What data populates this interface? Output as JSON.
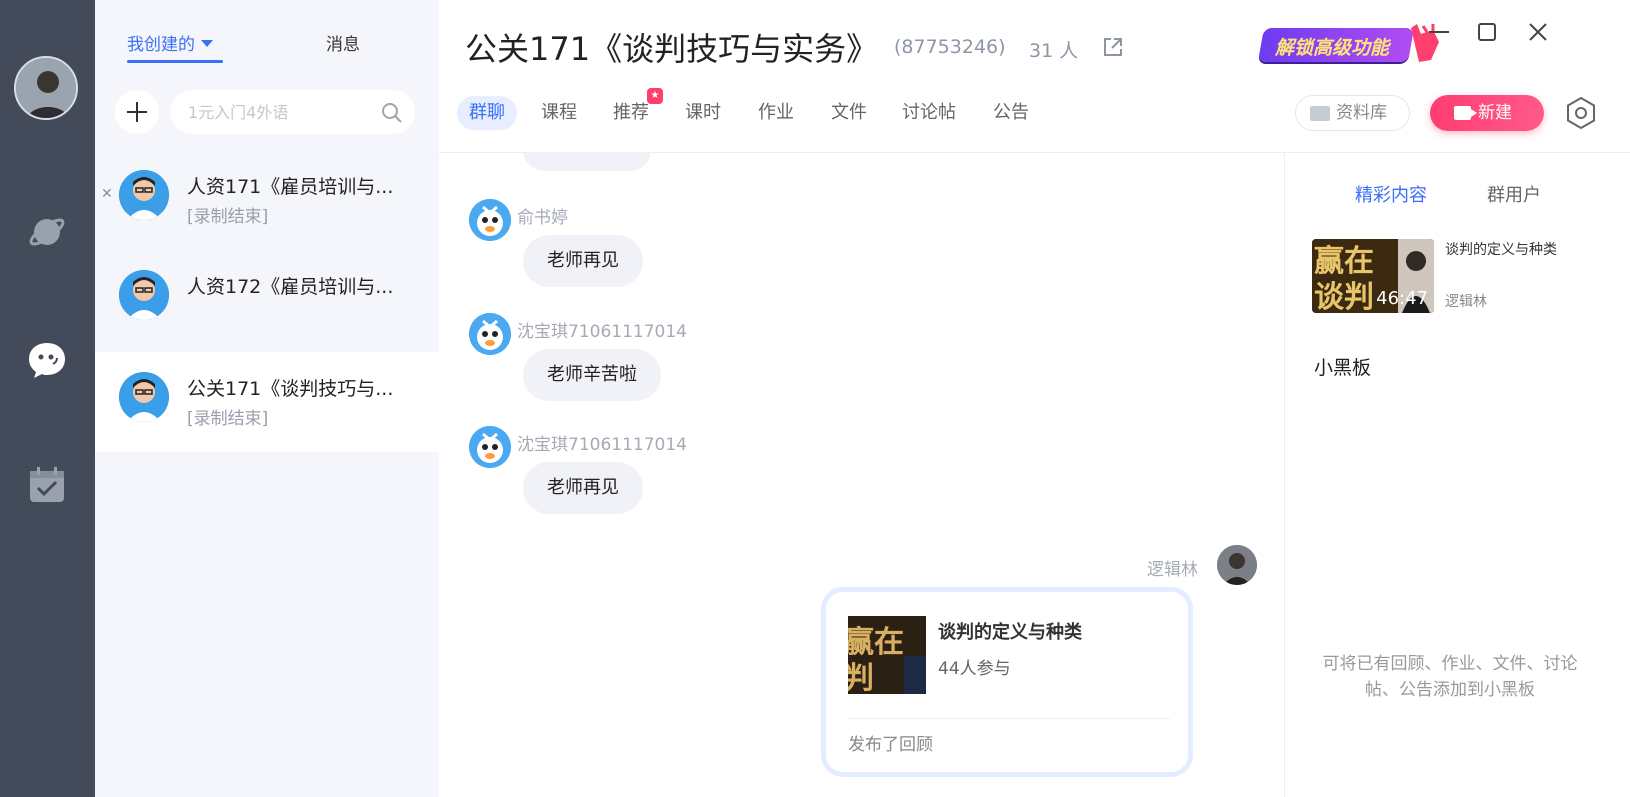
{
  "rail": {
    "icons": [
      "planet-icon",
      "chat-bubble-icon",
      "calendar-check-icon"
    ]
  },
  "sessions": {
    "tab_mine": "我创建的",
    "tab_messages": "消息",
    "search_placeholder": "1元入门4外语",
    "items": [
      {
        "name": "人资171《雇员培训与...",
        "status": "[录制结束]"
      },
      {
        "name": "人资172《雇员培训与...",
        "status": ""
      },
      {
        "name": "公关171《谈判技巧与...",
        "status": "[录制结束]"
      }
    ]
  },
  "header": {
    "title": "公关171《谈判技巧与实务》",
    "group_id": "(87753246)",
    "member_count": "31 人",
    "unlock_label": "解锁高级功能",
    "tabs": [
      "群聊",
      "课程",
      "推荐",
      "课时",
      "作业",
      "文件",
      "讨论帖",
      "公告"
    ],
    "library_label": "资料库",
    "new_label": "新建"
  },
  "chat": {
    "messages": [
      {
        "sender": "俞书婷",
        "text": "老师再见"
      },
      {
        "sender": "沈宝琪71061117014",
        "text": "老师辛苦啦"
      },
      {
        "sender": "沈宝琪71061117014",
        "text": "老师再见"
      }
    ],
    "mine": {
      "sender": "逻辑林",
      "card_title": "谈判的定义与种类",
      "card_sub": "44人参与",
      "card_footer": "发布了回顾",
      "thumb_text": "赢在\n判"
    }
  },
  "right": {
    "tab_featured": "精彩内容",
    "tab_users": "群用户",
    "video_title": "谈判的定义与种类",
    "video_author": "逻辑林",
    "video_duration": "46:47",
    "video_thumb_text": "赢在\n谈判",
    "board_title": "小黑板",
    "board_hint": "可将已有回顾、作业、文件、讨论帖、公告添加到小黑板"
  },
  "colors": {
    "accent": "#3a6ff7",
    "rail": "#434a5a",
    "new_button": "#ff3d71"
  }
}
